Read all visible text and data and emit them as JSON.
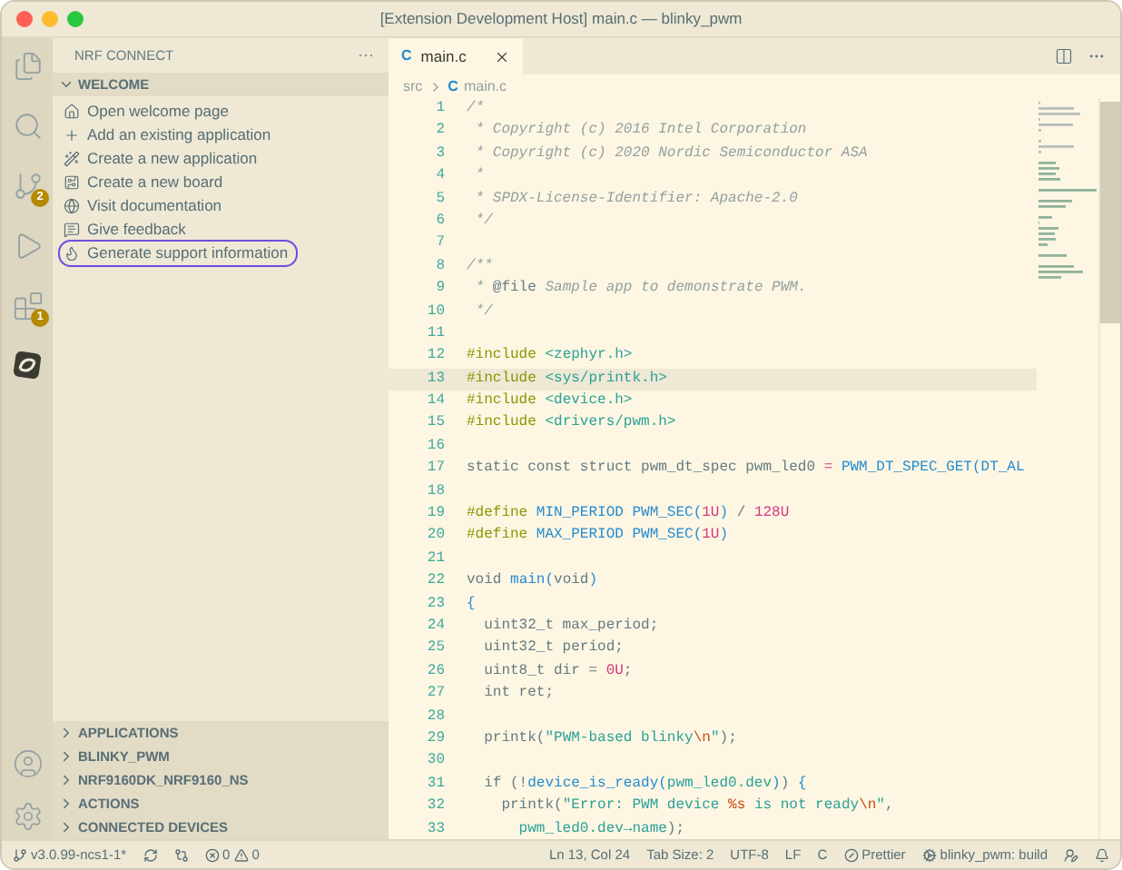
{
  "window": {
    "title": "[Extension Development Host] main.c — blinky_pwm"
  },
  "activity_bar": {
    "items": [
      {
        "selected": false
      },
      {
        "selected": false
      },
      {
        "selected": false,
        "badge": "2"
      },
      {
        "selected": false
      },
      {
        "selected": false,
        "badge": "1"
      },
      {
        "selected": true
      }
    ]
  },
  "sidebar": {
    "title": "NRF CONNECT",
    "more": "···",
    "welcome": {
      "label": "WELCOME",
      "expanded": true,
      "items": [
        {
          "label": "Open welcome page",
          "selected": false
        },
        {
          "label": "Add an existing application",
          "selected": false
        },
        {
          "label": "Create a new application",
          "selected": false
        },
        {
          "label": "Create a new board",
          "selected": false
        },
        {
          "label": "Visit documentation",
          "selected": false
        },
        {
          "label": "Give feedback",
          "selected": false
        },
        {
          "label": "Generate support information",
          "selected": true
        }
      ]
    },
    "sections": [
      {
        "label": "APPLICATIONS",
        "expanded": false
      },
      {
        "label": "BLINKY_PWM",
        "expanded": false
      },
      {
        "label": "NRF9160DK_NRF9160_NS",
        "expanded": false
      },
      {
        "label": "ACTIONS",
        "expanded": false
      },
      {
        "label": "CONNECTED DEVICES",
        "expanded": false
      }
    ]
  },
  "editor": {
    "tabs": [
      {
        "label": "main.c",
        "selected": true,
        "lang": "C"
      }
    ],
    "breadcrumbs": [
      {
        "label": "src"
      },
      {
        "label": "main.c",
        "lang": "C"
      }
    ],
    "lines": [
      {
        "n": "1",
        "highlighted": false,
        "tokens": [
          {
            "kind": "comment",
            "text": "/*"
          }
        ]
      },
      {
        "n": "2",
        "highlighted": false,
        "tokens": [
          {
            "kind": "comment",
            "text": " * Copyright (c) 2016 Intel Corporation"
          }
        ]
      },
      {
        "n": "3",
        "highlighted": false,
        "tokens": [
          {
            "kind": "comment",
            "text": " * Copyright (c) 2020 Nordic Semiconductor ASA"
          }
        ]
      },
      {
        "n": "4",
        "highlighted": false,
        "tokens": [
          {
            "kind": "comment",
            "text": " *"
          }
        ]
      },
      {
        "n": "5",
        "highlighted": false,
        "tokens": [
          {
            "kind": "comment",
            "text": " * SPDX-License-Identifier: Apache-2.0"
          }
        ]
      },
      {
        "n": "6",
        "highlighted": false,
        "tokens": [
          {
            "kind": "comment",
            "text": " */"
          }
        ]
      },
      {
        "n": "7",
        "highlighted": false
      },
      {
        "n": "8",
        "highlighted": false,
        "tokens": [
          {
            "kind": "comment",
            "text": "/**"
          }
        ]
      },
      {
        "n": "9",
        "highlighted": false,
        "tokens": [
          {
            "kind": "comment",
            "text": " * "
          },
          {
            "kind": "tag",
            "text": "@file"
          },
          {
            "kind": "comment",
            "text": " Sample app to demonstrate PWM."
          }
        ]
      },
      {
        "n": "10",
        "highlighted": false,
        "tokens": [
          {
            "kind": "comment",
            "text": " */"
          }
        ]
      },
      {
        "n": "11",
        "highlighted": false
      },
      {
        "n": "12",
        "highlighted": false,
        "tokens": [
          {
            "kind": "preproc",
            "text": "#include "
          },
          {
            "kind": "string",
            "text": "<zephyr.h>"
          }
        ]
      },
      {
        "n": "13",
        "highlighted": true,
        "tokens": [
          {
            "kind": "preproc",
            "text": "#include "
          },
          {
            "kind": "string",
            "text": "<sys/printk.h>"
          }
        ]
      },
      {
        "n": "14",
        "highlighted": false,
        "tokens": [
          {
            "kind": "preproc",
            "text": "#include "
          },
          {
            "kind": "string",
            "text": "<device.h>"
          }
        ]
      },
      {
        "n": "15",
        "highlighted": false,
        "tokens": [
          {
            "kind": "preproc",
            "text": "#include "
          },
          {
            "kind": "string",
            "text": "<drivers/pwm.h>"
          }
        ]
      },
      {
        "n": "16",
        "highlighted": false
      },
      {
        "n": "17",
        "highlighted": false,
        "tokens": [
          {
            "kind": "plain",
            "text": "static const struct pwm_dt_spec pwm_led0 "
          },
          {
            "kind": "number",
            "text": "= "
          },
          {
            "kind": "func",
            "text": "PWM_DT_SPEC_GET(DT_AL"
          }
        ]
      },
      {
        "n": "18",
        "highlighted": false
      },
      {
        "n": "19",
        "highlighted": false,
        "tokens": [
          {
            "kind": "preproc",
            "text": "#define "
          },
          {
            "kind": "func",
            "text": "MIN_PERIOD PWM_SEC("
          },
          {
            "kind": "number",
            "text": "1U"
          },
          {
            "kind": "func",
            "text": ")"
          },
          {
            "kind": "plain",
            "text": " / "
          },
          {
            "kind": "number",
            "text": "128U"
          }
        ]
      },
      {
        "n": "20",
        "highlighted": false,
        "tokens": [
          {
            "kind": "preproc",
            "text": "#define "
          },
          {
            "kind": "func",
            "text": "MAX_PERIOD PWM_SEC("
          },
          {
            "kind": "number",
            "text": "1U"
          },
          {
            "kind": "func",
            "text": ")"
          }
        ]
      },
      {
        "n": "21",
        "highlighted": false
      },
      {
        "n": "22",
        "highlighted": false,
        "tokens": [
          {
            "kind": "plain",
            "text": "void "
          },
          {
            "kind": "func",
            "text": "main("
          },
          {
            "kind": "plain",
            "text": "void"
          },
          {
            "kind": "func",
            "text": ")"
          }
        ]
      },
      {
        "n": "23",
        "highlighted": false,
        "tokens": [
          {
            "kind": "func",
            "text": "{"
          }
        ]
      },
      {
        "n": "24",
        "highlighted": false,
        "tokens": [
          {
            "kind": "plain",
            "text": "  uint32_t max_period;"
          }
        ]
      },
      {
        "n": "25",
        "highlighted": false,
        "tokens": [
          {
            "kind": "plain",
            "text": "  uint32_t period;"
          }
        ]
      },
      {
        "n": "26",
        "highlighted": false,
        "tokens": [
          {
            "kind": "plain",
            "text": "  uint8_t dir = "
          },
          {
            "kind": "number",
            "text": "0U"
          },
          {
            "kind": "plain",
            "text": ";"
          }
        ]
      },
      {
        "n": "27",
        "highlighted": false,
        "tokens": [
          {
            "kind": "plain",
            "text": "  int ret;"
          }
        ]
      },
      {
        "n": "28",
        "highlighted": false
      },
      {
        "n": "29",
        "highlighted": false,
        "tokens": [
          {
            "kind": "plain",
            "text": "  printk("
          },
          {
            "kind": "string",
            "text": "\"PWM-based blinky"
          },
          {
            "kind": "escape",
            "text": "\\n"
          },
          {
            "kind": "string",
            "text": "\""
          },
          {
            "kind": "plain",
            "text": ");"
          }
        ]
      },
      {
        "n": "30",
        "highlighted": false
      },
      {
        "n": "31",
        "highlighted": false,
        "tokens": [
          {
            "kind": "plain",
            "text": "  if (!"
          },
          {
            "kind": "func",
            "text": "device_is_ready("
          },
          {
            "kind": "string",
            "text": "pwm_led0.dev"
          },
          {
            "kind": "func",
            "text": ")"
          },
          {
            "kind": "plain",
            "text": ") "
          },
          {
            "kind": "func",
            "text": "{"
          }
        ]
      },
      {
        "n": "32",
        "highlighted": false,
        "tokens": [
          {
            "kind": "plain",
            "text": "    printk("
          },
          {
            "kind": "string",
            "text": "\"Error: PWM device "
          },
          {
            "kind": "escape",
            "text": "%s"
          },
          {
            "kind": "string",
            "text": " is not ready"
          },
          {
            "kind": "escape",
            "text": "\\n"
          },
          {
            "kind": "string",
            "text": "\""
          },
          {
            "kind": "plain",
            "text": ","
          }
        ]
      },
      {
        "n": "33",
        "highlighted": false,
        "tokens": [
          {
            "kind": "string",
            "text": "      pwm_led0.dev→name"
          },
          {
            "kind": "plain",
            "text": ");"
          }
        ]
      }
    ]
  },
  "status_bar": {
    "branch": "v3.0.99-ncs1-1*",
    "errors": "0",
    "warnings": "0",
    "right": [
      {
        "kind": "text",
        "text": "Ln 13, Col 24"
      },
      {
        "kind": "text",
        "text": "Tab Size: 2"
      },
      {
        "kind": "text",
        "text": "UTF-8"
      },
      {
        "kind": "text",
        "text": "LF"
      },
      {
        "kind": "text",
        "text": "C"
      },
      {
        "kind": "prettier",
        "text": "Prettier"
      },
      {
        "kind": "task",
        "text": "blinky_pwm: build"
      }
    ]
  }
}
